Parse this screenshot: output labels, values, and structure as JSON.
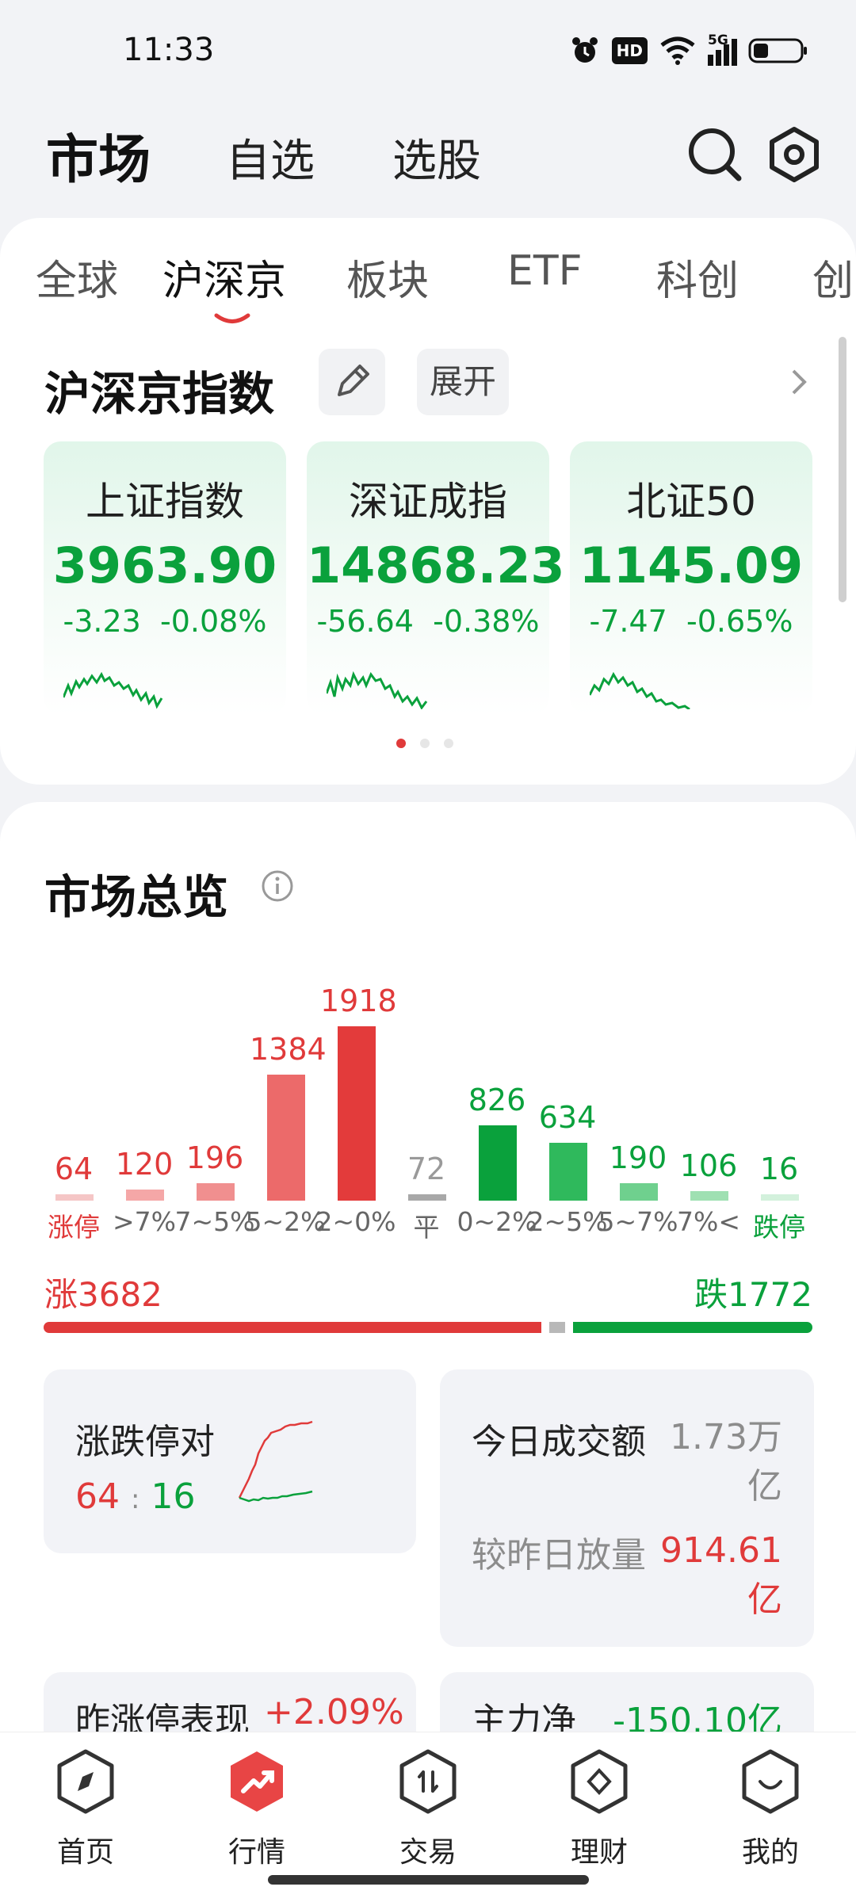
{
  "status_bar": {
    "time": "11:33",
    "hd": "HD",
    "net": "5G"
  },
  "header": {
    "title": "市场",
    "tab_watchlist": "自选",
    "tab_screener": "选股"
  },
  "tabs": [
    "全球",
    "沪深京",
    "板块",
    "ETF",
    "科创",
    "创"
  ],
  "active_tab": "沪深京",
  "indices_section": {
    "title": "沪深京指数",
    "expand_label": "展开",
    "cards": [
      {
        "name": "上证指数",
        "value": "3963.90",
        "change": "-3.23",
        "pct": "-0.08%"
      },
      {
        "name": "深证成指",
        "value": "14868.23",
        "change": "-56.64",
        "pct": "-0.38%"
      },
      {
        "name": "北证50",
        "value": "1145.09",
        "change": "-7.47",
        "pct": "-0.65%"
      }
    ],
    "page_dots": 3,
    "active_dot": 1
  },
  "overview": {
    "title": "市场总览",
    "distribution": [
      {
        "label": "涨停",
        "count": 64,
        "color": "#e03a3a",
        "bar": "#f5c6c6"
      },
      {
        "label": ">7%",
        "count": 120,
        "color": "#e03a3a",
        "bar": "#f5a7a7"
      },
      {
        "label": "7~5%",
        "count": 196,
        "color": "#e03a3a",
        "bar": "#f08f8f"
      },
      {
        "label": "5~2%",
        "count": 1384,
        "color": "#e03a3a",
        "bar": "#ec6a6a"
      },
      {
        "label": "2~0%",
        "count": 1918,
        "color": "#e03a3a",
        "bar": "#e33b3b"
      },
      {
        "label": "平",
        "count": 72,
        "color": "#9a9a9a",
        "bar": "#a8a8a8"
      },
      {
        "label": "0~2%",
        "count": 826,
        "color": "#0aa13c",
        "bar": "#0aa13c"
      },
      {
        "label": "2~5%",
        "count": 634,
        "color": "#0aa13c",
        "bar": "#2fb95c"
      },
      {
        "label": "5~7%",
        "count": 190,
        "color": "#0aa13c",
        "bar": "#6fd08e"
      },
      {
        "label": "7%<",
        "count": 106,
        "color": "#0aa13c",
        "bar": "#9fe0b2"
      },
      {
        "label": "跌停",
        "count": 16,
        "color": "#0aa13c",
        "bar": "#d3f1dc"
      }
    ],
    "up_label": "涨3682",
    "down_label": "跌1772",
    "up_total": 3682,
    "down_total": 1772,
    "limit_card": {
      "title": "涨跌停对",
      "up": "64",
      "sep": ":",
      "down": "16"
    },
    "turnover_card": {
      "title": "今日成交额",
      "value": "1.73万",
      "value_unit": "亿",
      "compare_label": "较昨日放量",
      "compare_value": "914.61",
      "compare_unit": "亿"
    },
    "yesterday_card": {
      "title": "昨涨停表现",
      "value": "+2.09%"
    },
    "mainflow_card": {
      "title": "主力净",
      "value": "-150.10亿"
    }
  },
  "bottom_nav": [
    {
      "label": "首页",
      "active": false
    },
    {
      "label": "行情",
      "active": true
    },
    {
      "label": "交易",
      "active": false
    },
    {
      "label": "理财",
      "active": false
    },
    {
      "label": "我的",
      "active": false
    }
  ],
  "colors": {
    "up": "#e03a3a",
    "down": "#0aa13c",
    "accent": "#e84545"
  }
}
